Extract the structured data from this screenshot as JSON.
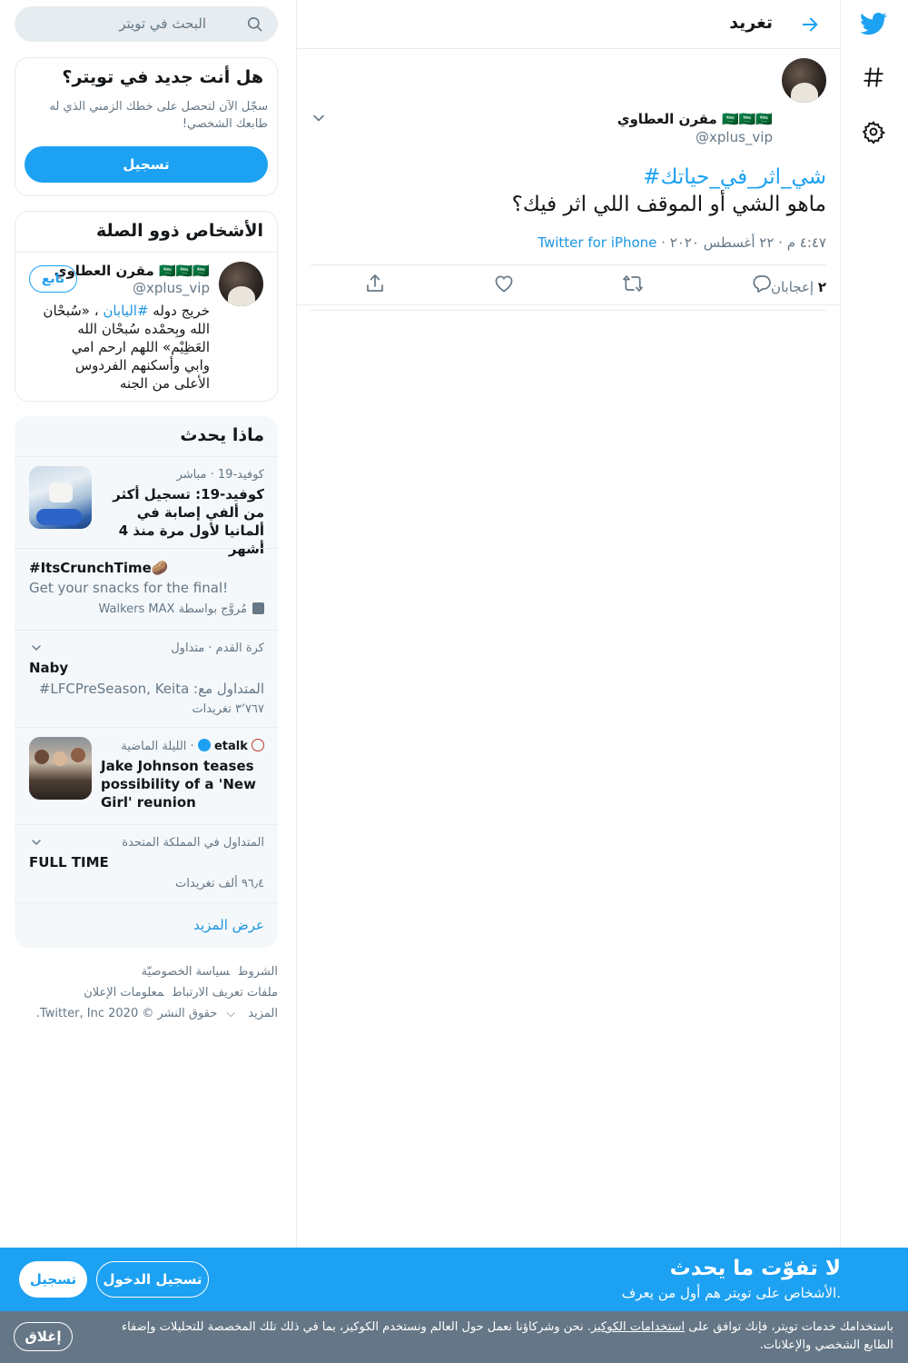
{
  "colors": {
    "accent": "#1da1f2",
    "link": "#1b95e0",
    "muted": "#657786",
    "border": "#e6ecf0"
  },
  "nav": {
    "icons": [
      "twitter-logo-icon",
      "hashtag-icon",
      "gear-icon"
    ]
  },
  "header": {
    "title": "تغريد"
  },
  "tweet": {
    "author_name": "مقرن العطاوي 🇸🇦🇸🇦🇸🇦",
    "author_handle": "@xplus_vip",
    "hashtag": "#شي_اثر_في_حياتك",
    "body": "ماهو الشي أو الموقف اللي اثر فيك؟",
    "time": "٤:٤٧ م · ٢٢ أغسطس ٢٠٢٠ · ",
    "source": "Twitter for iPhone",
    "likes_count": "٢",
    "likes_label": " إعجابان"
  },
  "search": {
    "placeholder": "البحث في تويتر"
  },
  "new_to_twitter": {
    "title": "هل أنت جديد في تويتر؟",
    "text": "سجّل الآن لتحصل على خطك الزمني الذي له طابعك الشخصي!",
    "button": "تسجيل"
  },
  "relevant": {
    "title": "الأشخاص ذوو الصلة",
    "name": "مقرن العطاوي 🇸🇦🇸🇦🇸🇦",
    "handle": "@xplus_vip",
    "follow": "تابع",
    "bio_pre": "خريج دوله ",
    "bio_tag": "#اليابان",
    "bio_post": " ، «سُبحْان الله وبِحمْده سُبحْان الله العَظِيْم» اللهم ارحم امي وابي وأسكنهم الفردوس الأعلى من الجنه"
  },
  "trends": {
    "title": "ماذا يحدث",
    "items": [
      {
        "meta": "كوفيد-19 · مباشر",
        "title": "كوفيد-19: تسجيل أكثر من ألفي إصابة في ألمانيا لأول مرة منذ 4 أشهر"
      },
      {
        "title": "#ItsCrunchTime🥔",
        "sub": "Get your snacks for the final!",
        "promoted": "مُروَّج بواسطة Walkers MAX"
      },
      {
        "meta": "كرة القدم · متداول",
        "title": "Naby",
        "sub": "المتداول مع: LFCPreSeason, Keita#",
        "count": "٣٬٧٦٧ تغريدات"
      },
      {
        "source": "etalk",
        "time": "الليلة الماضية",
        "title": "Jake Johnson teases possibility of a 'New Girl' reunion"
      },
      {
        "meta": "المتداول في المملكة المتحدة",
        "title": "FULL TIME",
        "count": "٩٦٫٤ ألف تغريدات"
      }
    ],
    "show_more": "عرض المزيد"
  },
  "footer": {
    "terms": "الشروط",
    "privacy": "سياسة الخصوصيّة",
    "cookies": "ملفات تعريف الارتباط",
    "ads": "معلومات الإعلان",
    "more": "المزيد",
    "copyright": "حقوق النشر © 2020 Twitter, Inc."
  },
  "banner": {
    "title": "لا تفوّت ما يحدث",
    "text": "الأشخاص على تويتر هم أول من يعرف.",
    "login": "تسجيل الدخول",
    "signup": "تسجيل"
  },
  "cookie": {
    "pre": "باستخدامك خدمات تويتر، فإنك توافق على ",
    "link": "استخدامات الكوكيز",
    "post": ". نحن وشركاؤنا نعمل حول العالم ونستخدم الكوكيز، بما في ذلك تلك المخصصة للتحليلات وإضفاء الطابع الشخصي والإعلانات.",
    "close": "إغلاق"
  }
}
